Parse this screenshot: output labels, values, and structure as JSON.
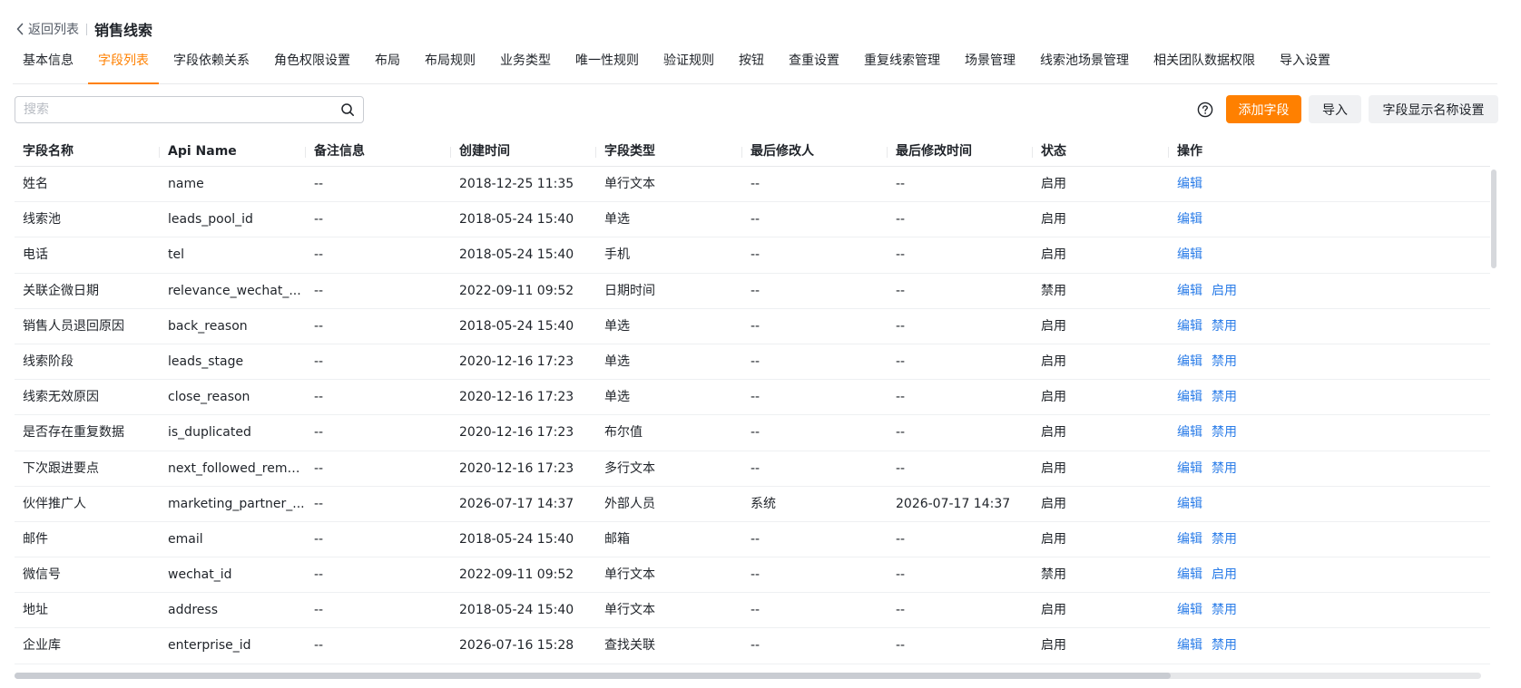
{
  "header": {
    "back_label": "返回列表",
    "title": "销售线索"
  },
  "tabs": [
    {
      "label": "基本信息"
    },
    {
      "label": "字段列表",
      "active": true
    },
    {
      "label": "字段依赖关系"
    },
    {
      "label": "角色权限设置"
    },
    {
      "label": "布局"
    },
    {
      "label": "布局规则"
    },
    {
      "label": "业务类型"
    },
    {
      "label": "唯一性规则"
    },
    {
      "label": "验证规则"
    },
    {
      "label": "按钮"
    },
    {
      "label": "查重设置"
    },
    {
      "label": "重复线索管理"
    },
    {
      "label": "场景管理"
    },
    {
      "label": "线索池场景管理"
    },
    {
      "label": "相关团队数据权限"
    },
    {
      "label": "导入设置"
    }
  ],
  "toolbar": {
    "search_placeholder": "搜索",
    "add_field_label": "添加字段",
    "import_label": "导入",
    "display_name_label": "字段显示名称设置"
  },
  "table": {
    "columns": [
      "字段名称",
      "Api Name",
      "备注信息",
      "创建时间",
      "字段类型",
      "最后修改人",
      "最后修改时间",
      "状态",
      "操作"
    ],
    "rows": [
      {
        "name": "姓名",
        "api": "name",
        "remark": "--",
        "created": "2018-12-25 11:35",
        "type": "单行文本",
        "modifier": "--",
        "modified": "--",
        "status": "启用",
        "actions": [
          "编辑"
        ]
      },
      {
        "name": "线索池",
        "api": "leads_pool_id",
        "remark": "--",
        "created": "2018-05-24 15:40",
        "type": "单选",
        "modifier": "--",
        "modified": "--",
        "status": "启用",
        "actions": [
          "编辑"
        ]
      },
      {
        "name": "电话",
        "api": "tel",
        "remark": "--",
        "created": "2018-05-24 15:40",
        "type": "手机",
        "modifier": "--",
        "modified": "--",
        "status": "启用",
        "actions": [
          "编辑"
        ]
      },
      {
        "name": "关联企微日期",
        "api": "relevance_wechat_...",
        "remark": "--",
        "created": "2022-09-11 09:52",
        "type": "日期时间",
        "modifier": "--",
        "modified": "--",
        "status": "禁用",
        "actions": [
          "编辑",
          "启用"
        ]
      },
      {
        "name": "销售人员退回原因",
        "api": "back_reason",
        "remark": "--",
        "created": "2018-05-24 15:40",
        "type": "单选",
        "modifier": "--",
        "modified": "--",
        "status": "启用",
        "actions": [
          "编辑",
          "禁用"
        ]
      },
      {
        "name": "线索阶段",
        "api": "leads_stage",
        "remark": "--",
        "created": "2020-12-16 17:23",
        "type": "单选",
        "modifier": "--",
        "modified": "--",
        "status": "启用",
        "actions": [
          "编辑",
          "禁用"
        ]
      },
      {
        "name": "线索无效原因",
        "api": "close_reason",
        "remark": "--",
        "created": "2020-12-16 17:23",
        "type": "单选",
        "modifier": "--",
        "modified": "--",
        "status": "启用",
        "actions": [
          "编辑",
          "禁用"
        ]
      },
      {
        "name": "是否存在重复数据",
        "api": "is_duplicated",
        "remark": "--",
        "created": "2020-12-16 17:23",
        "type": "布尔值",
        "modifier": "--",
        "modified": "--",
        "status": "启用",
        "actions": [
          "编辑",
          "禁用"
        ]
      },
      {
        "name": "下次跟进要点",
        "api": "next_followed_remark",
        "remark": "--",
        "created": "2020-12-16 17:23",
        "type": "多行文本",
        "modifier": "--",
        "modified": "--",
        "status": "启用",
        "actions": [
          "编辑",
          "禁用"
        ]
      },
      {
        "name": "伙伴推广人",
        "api": "marketing_partner_...",
        "remark": "--",
        "created": "2026-07-17 14:37",
        "type": "外部人员",
        "modifier": "系统",
        "modified": "2026-07-17 14:37",
        "status": "启用",
        "actions": [
          "编辑"
        ]
      },
      {
        "name": "邮件",
        "api": "email",
        "remark": "--",
        "created": "2018-05-24 15:40",
        "type": "邮箱",
        "modifier": "--",
        "modified": "--",
        "status": "启用",
        "actions": [
          "编辑",
          "禁用"
        ]
      },
      {
        "name": "微信号",
        "api": "wechat_id",
        "remark": "--",
        "created": "2022-09-11 09:52",
        "type": "单行文本",
        "modifier": "--",
        "modified": "--",
        "status": "禁用",
        "actions": [
          "编辑",
          "启用"
        ]
      },
      {
        "name": "地址",
        "api": "address",
        "remark": "--",
        "created": "2018-05-24 15:40",
        "type": "单行文本",
        "modifier": "--",
        "modified": "--",
        "status": "启用",
        "actions": [
          "编辑",
          "禁用"
        ]
      },
      {
        "name": "企业库",
        "api": "enterprise_id",
        "remark": "--",
        "created": "2026-07-16 15:28",
        "type": "查找关联",
        "modifier": "--",
        "modified": "--",
        "status": "启用",
        "actions": [
          "编辑",
          "禁用"
        ]
      }
    ]
  },
  "colors": {
    "accent": "#ff8000",
    "link": "#2a7ce8",
    "text": "#1f2329"
  }
}
